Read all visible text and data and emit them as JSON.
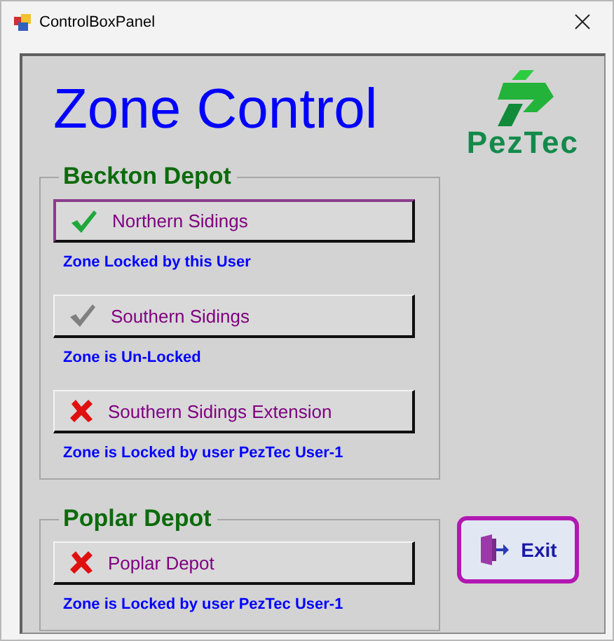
{
  "window": {
    "title": "ControlBoxPanel"
  },
  "heading": "Zone Control",
  "logo": {
    "text": "PezTec"
  },
  "groups": [
    {
      "title": "Beckton Depot",
      "zones": [
        {
          "label": "Northern Sidings",
          "kind": "locked_by_me",
          "focused": true,
          "status": "Zone Locked by this User"
        },
        {
          "label": "Southern Sidings",
          "kind": "unlocked",
          "focused": false,
          "status": "Zone is Un-Locked"
        },
        {
          "label": "Southern Sidings Extension",
          "kind": "locked_other",
          "focused": false,
          "status": "Zone is Locked by user PezTec User-1"
        }
      ]
    },
    {
      "title": "Poplar Depot",
      "zones": [
        {
          "label": "Poplar Depot",
          "kind": "locked_other",
          "focused": false,
          "status": "Zone is Locked by user PezTec User-1"
        }
      ]
    }
  ],
  "exit_button": {
    "label": "Exit"
  }
}
